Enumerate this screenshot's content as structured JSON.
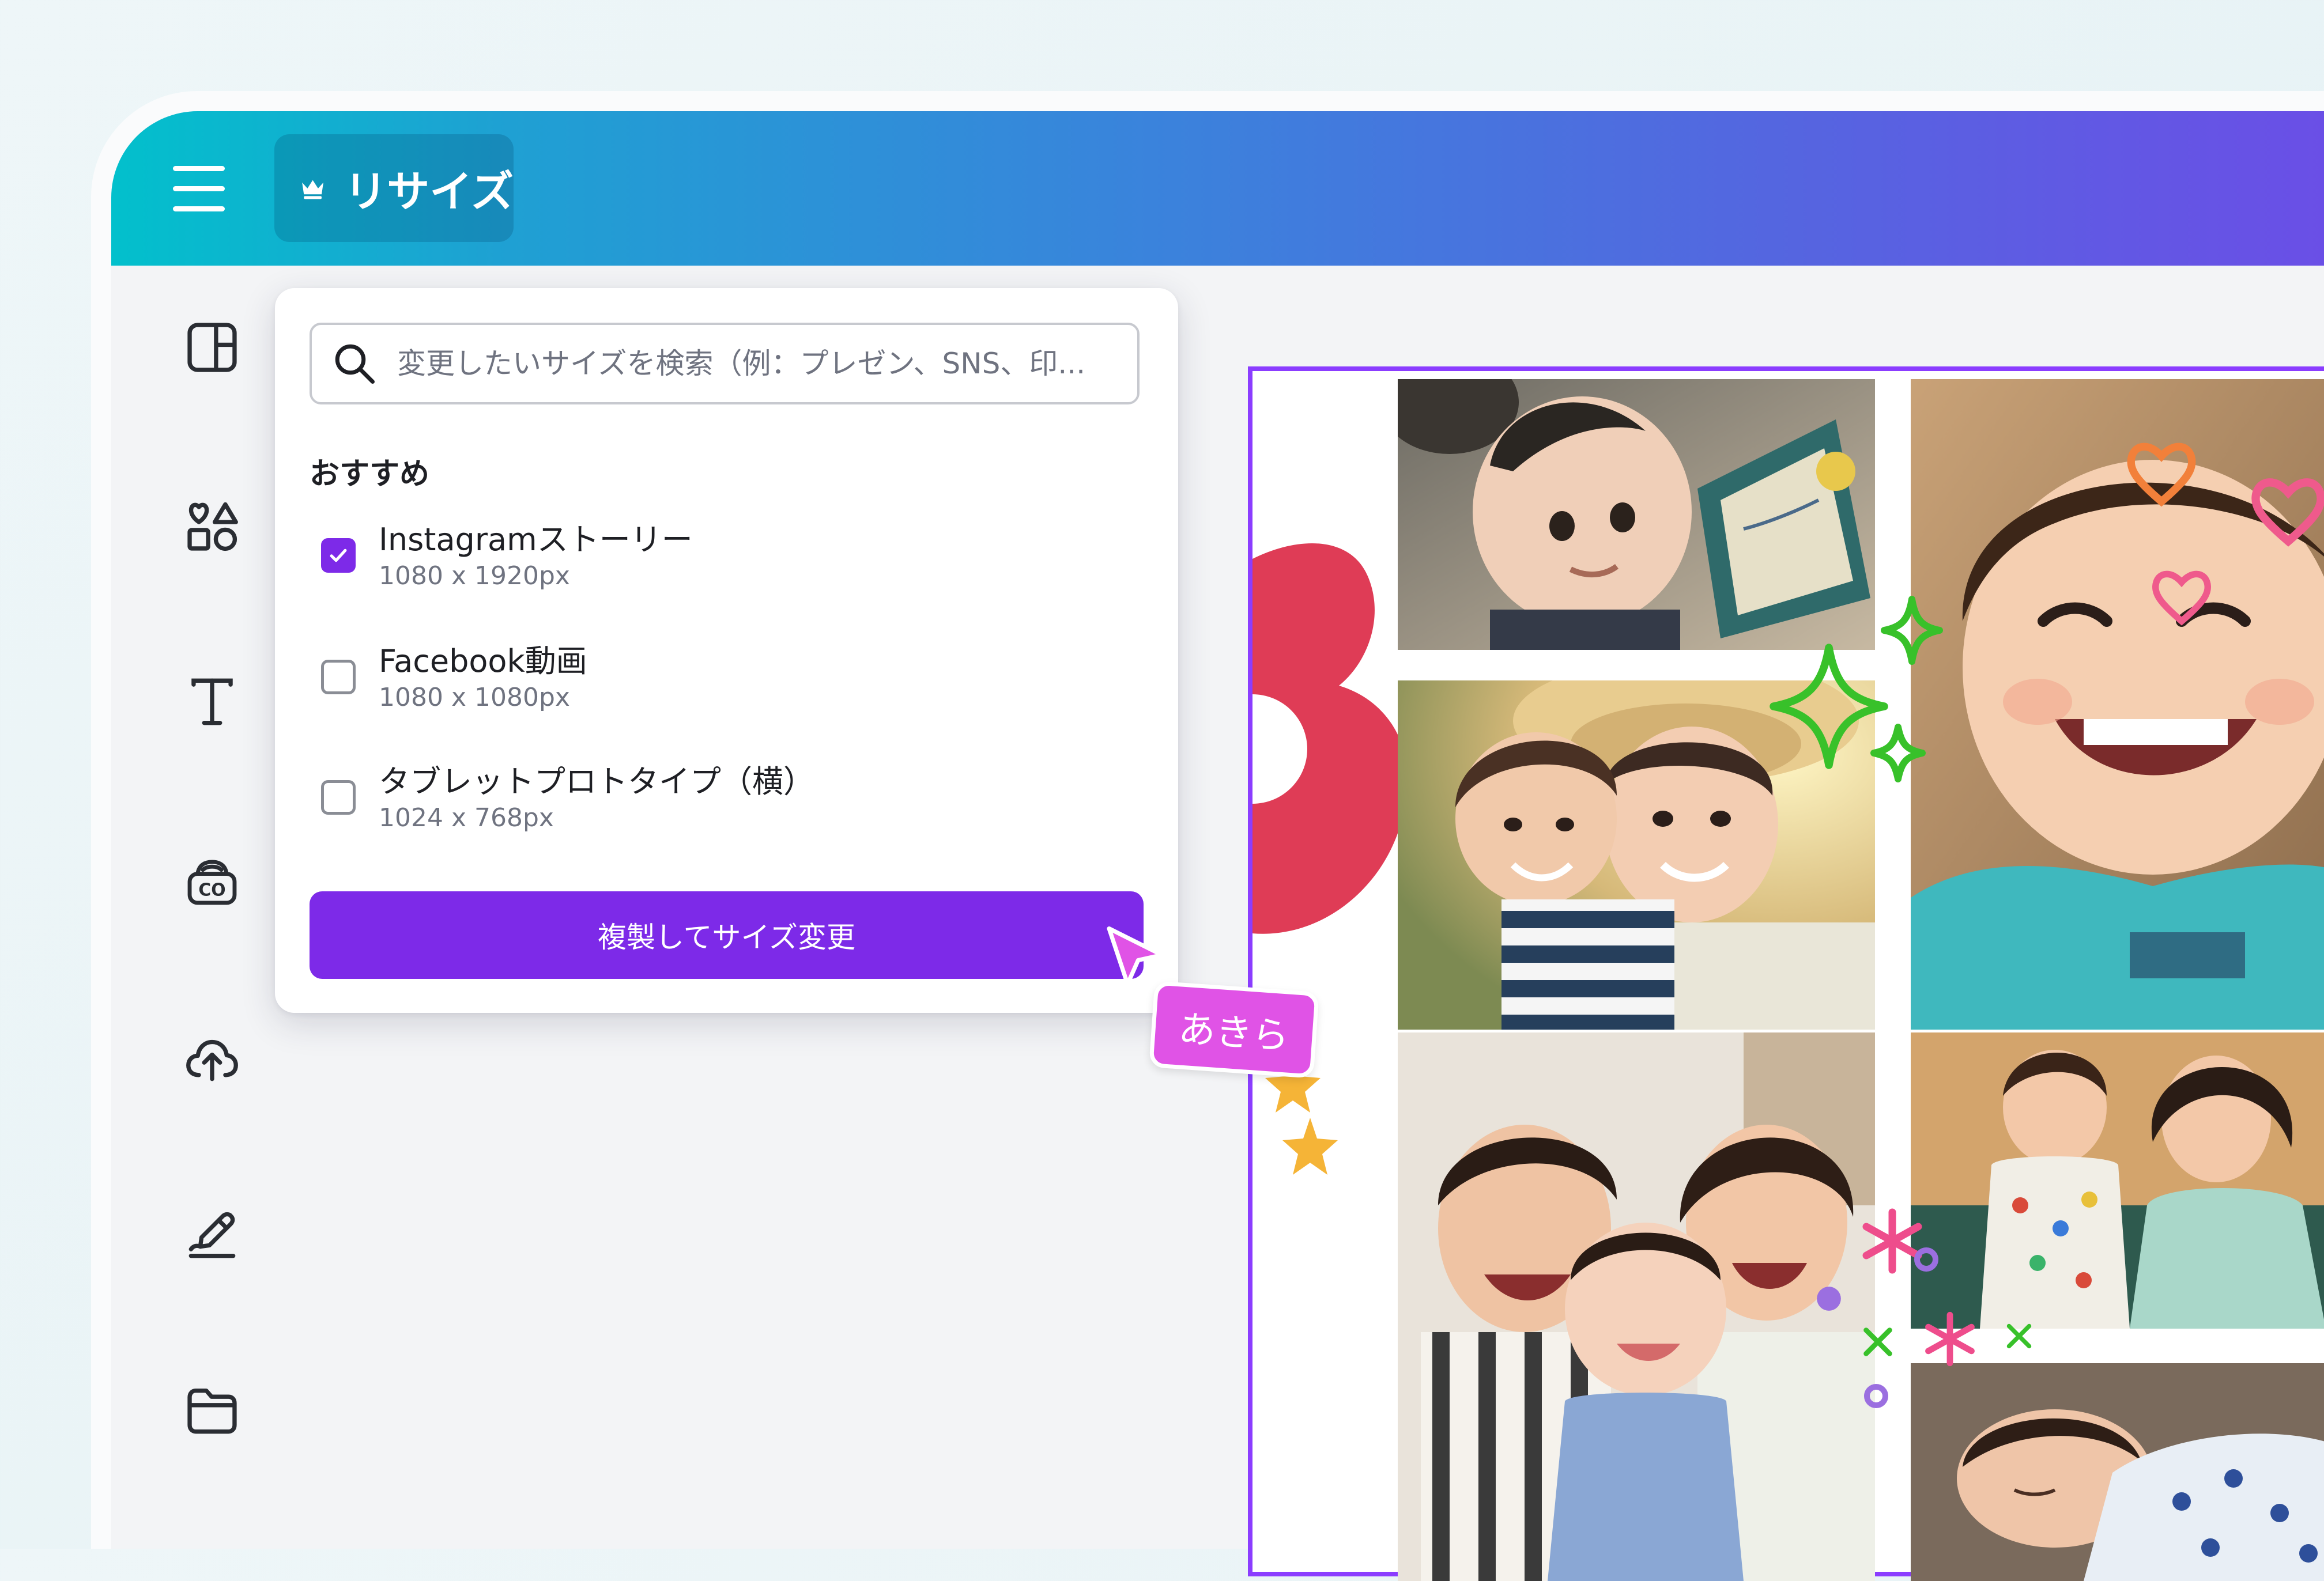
{
  "header": {
    "resize_button_label": "リサイズ"
  },
  "sidebar": {
    "items": [
      {
        "icon": "layout-icon"
      },
      {
        "icon": "elements-icon"
      },
      {
        "icon": "text-icon"
      },
      {
        "icon": "brand-icon"
      },
      {
        "icon": "upload-icon"
      },
      {
        "icon": "draw-icon"
      },
      {
        "icon": "folder-icon"
      }
    ]
  },
  "resize_panel": {
    "search_placeholder": "変更したいサイズを検索（例：プレゼン、SNS、印...",
    "section_title": "おすすめ",
    "options": [
      {
        "name": "Instagramストーリー",
        "size": "1080 x 1920px",
        "checked": true
      },
      {
        "name": "Facebook動画",
        "size": "1080 x 1080px",
        "checked": false
      },
      {
        "name": "タブレットプロトタイプ（横）",
        "size": "1024 x 768px",
        "checked": false
      }
    ],
    "submit_label": "複製してサイズ変更"
  },
  "collaborator": {
    "name": "あきら",
    "color": "#e053e6"
  },
  "canvas": {
    "selection_color": "#8b3dff",
    "photos": [
      "baby-reading-book-photo",
      "boy-hugging-mother-photo",
      "smiling-toddler-selfie-photo",
      "family-with-baby-photo",
      "child-with-mother-photo",
      "sleeping-baby-photo"
    ]
  },
  "colors": {
    "accent_purple": "#7d2ae8",
    "header_gradient_start": "#02c0cc",
    "header_gradient_end": "#6a4fe6"
  }
}
